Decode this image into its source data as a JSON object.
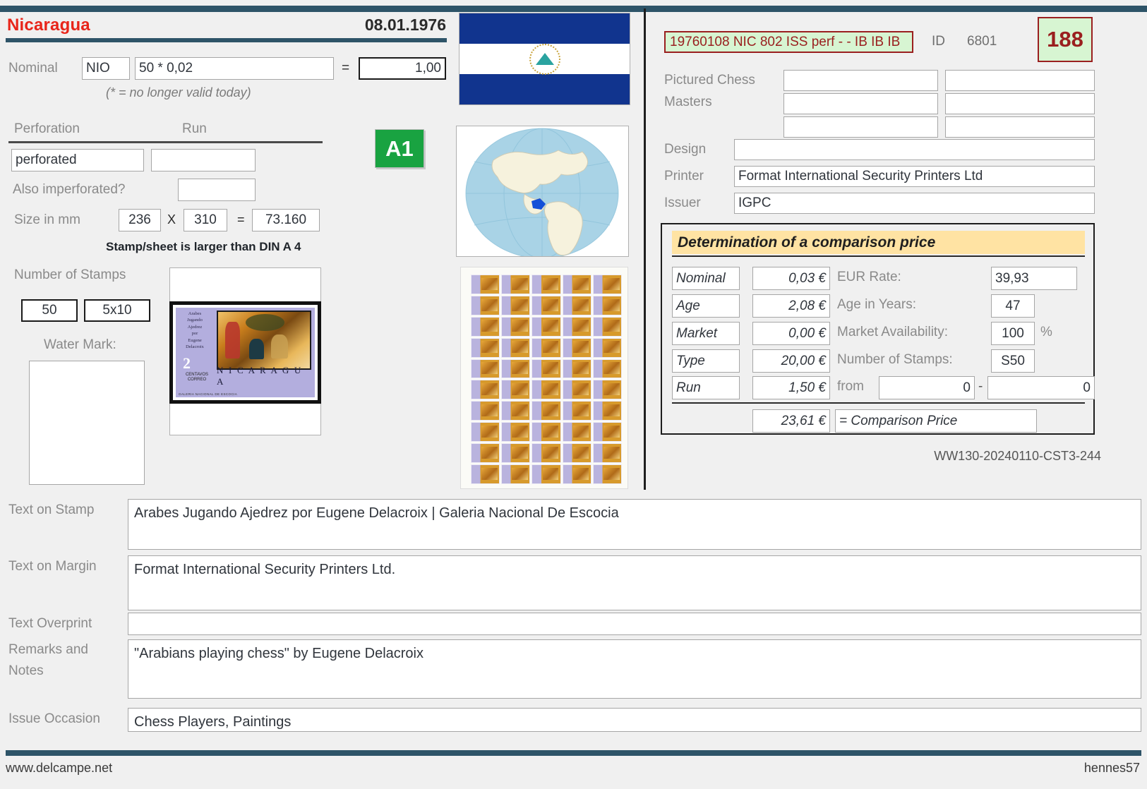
{
  "header": {
    "country": "Nicaragua",
    "issue_date": "08.01.1976"
  },
  "nominal": {
    "label": "Nominal",
    "currency": "NIO",
    "expression": "50 * 0,02",
    "equals": "=",
    "total": "1,00",
    "note": "(* = no longer valid today)"
  },
  "perforation": {
    "label": "Perforation",
    "run_label": "Run",
    "value": "perforated",
    "run_value": "",
    "also_imperf_label": "Also imperforated?",
    "also_imperf_value": "",
    "size_label": "Size in mm",
    "width": "236",
    "x": "X",
    "height": "310",
    "eq": "=",
    "area": "73.160",
    "din_note": "Stamp/sheet is larger than DIN A 4"
  },
  "badge": {
    "grade": "A1"
  },
  "stamps": {
    "number_label": "Number of Stamps",
    "count": "50",
    "layout": "5x10",
    "watermark_label": "Water Mark:",
    "watermark_value": ""
  },
  "images": {
    "flag_name": "nicaragua-flag",
    "globe_name": "world-globe-nicaragua-highlighted",
    "sheet_name": "stamp-sheet-5x10",
    "stamp_name": "nicaragua-2-centavos-delacroix-stamp",
    "stamp_caption_lines": [
      "Arabes",
      "Jugando",
      "Ajedrez",
      "por",
      "Eugene",
      "Delacroix"
    ],
    "stamp_value": "2",
    "stamp_value_sub": "CENTAVOS CORREO",
    "stamp_country": "N I C A R A G U A"
  },
  "catalog": {
    "code": "19760108 NIC 802 ISS perf - - IB IB IB",
    "id_label": "ID",
    "id_value": "6801",
    "rank": "188"
  },
  "details": {
    "pictured_chess_label": "Pictured Chess",
    "masters_label": "Masters",
    "masters_values": [
      "",
      "",
      "",
      "",
      "",
      ""
    ],
    "design_label": "Design",
    "design_value": "",
    "printer_label": "Printer",
    "printer_value": "Format International Security Printers Ltd",
    "issuer_label": "Issuer",
    "issuer_value": "IGPC"
  },
  "comparison": {
    "title": "Determination of a comparison price",
    "rows": [
      {
        "name": "Nominal",
        "amount": "0,03 €",
        "right_label": "EUR Rate:",
        "right_value": "39,93"
      },
      {
        "name": "Age",
        "amount": "2,08 €",
        "right_label": "Age in Years:",
        "right_value": "47"
      },
      {
        "name": "Market",
        "amount": "0,00 €",
        "right_label": "Market Availability:",
        "right_value": "100",
        "suffix": "%"
      },
      {
        "name": "Type",
        "amount": "20,00 €",
        "right_label": "Number of Stamps:",
        "right_value": "S50"
      },
      {
        "name": "Run",
        "amount": "1,50 €",
        "right_label": "from",
        "right_value": "0",
        "range_sep": "-",
        "range_to": "0"
      }
    ],
    "total_amount": "23,61 €",
    "total_label": "= Comparison Price",
    "ww_code": "WW130-20240110-CST3-244"
  },
  "texts": {
    "text_on_stamp_label": "Text on Stamp",
    "text_on_stamp_value": "Arabes Jugando Ajedrez por Eugene Delacroix | Galeria Nacional De Escocia",
    "text_on_margin_label": "Text on Margin",
    "text_on_margin_value": "Format International Security Printers Ltd.",
    "text_overprint_label": "Text Overprint",
    "text_overprint_value": "",
    "remarks_label_line1": "Remarks and",
    "remarks_label_line2": "Notes",
    "remarks_value": "\"Arabians playing chess\" by Eugene Delacroix",
    "issue_occasion_label": "Issue Occasion",
    "issue_occasion_value": "Chess Players, Paintings"
  },
  "footer": {
    "left": "www.delcampe.net",
    "right": "hennes57"
  },
  "colors": {
    "rule": "#2e5468",
    "country": "#e8251a",
    "accent_green": "#19a341",
    "catalog_red": "#9a1f1f",
    "catalog_bg": "#d7f5d2",
    "title_yellow": "#ffe3a3"
  }
}
